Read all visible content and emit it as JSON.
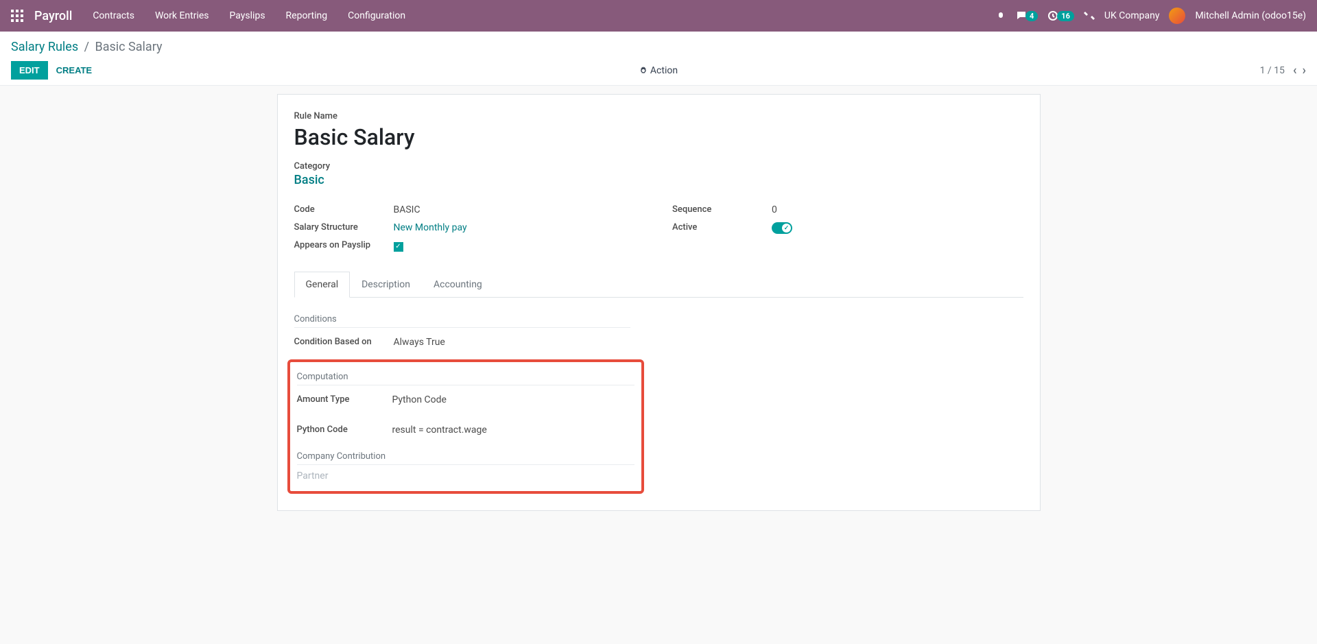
{
  "header": {
    "brand": "Payroll",
    "menu": [
      "Contracts",
      "Work Entries",
      "Payslips",
      "Reporting",
      "Configuration"
    ],
    "messages_badge": "4",
    "activities_badge": "16",
    "company": "UK Company",
    "user": "Mitchell Admin (odoo15e)"
  },
  "breadcrumb": {
    "parent": "Salary Rules",
    "current": "Basic Salary"
  },
  "controls": {
    "edit": "EDIT",
    "create": "CREATE",
    "action": "Action",
    "pager": "1 / 15"
  },
  "form": {
    "rule_name_label": "Rule Name",
    "rule_name": "Basic Salary",
    "category_label": "Category",
    "category": "Basic",
    "code_label": "Code",
    "code": "BASIC",
    "salary_structure_label": "Salary Structure",
    "salary_structure": "New Monthly pay",
    "appears_on_payslip_label": "Appears on Payslip",
    "sequence_label": "Sequence",
    "sequence": "0",
    "active_label": "Active"
  },
  "tabs": [
    "General",
    "Description",
    "Accounting"
  ],
  "conditions": {
    "header": "Conditions",
    "condition_based_on_label": "Condition Based on",
    "condition_based_on": "Always True"
  },
  "computation": {
    "header": "Computation",
    "amount_type_label": "Amount Type",
    "amount_type": "Python Code",
    "python_code_label": "Python Code",
    "python_code": "result = contract.wage"
  },
  "company_contribution": {
    "header": "Company Contribution",
    "partner_label": "Partner"
  }
}
